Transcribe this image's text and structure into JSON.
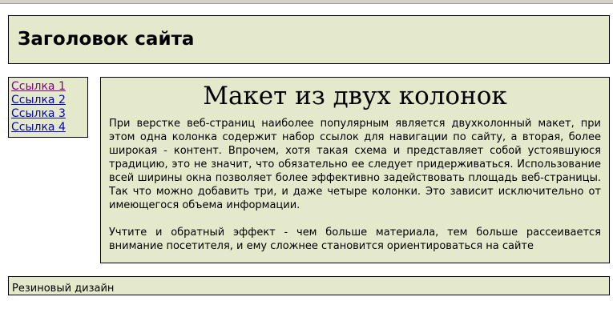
{
  "header": {
    "title": "Заголовок сайта"
  },
  "nav": {
    "links": [
      "Ссылка 1",
      "Ссылка 2",
      "Ссылка 3",
      "Ссылка 4"
    ]
  },
  "content": {
    "heading": "Макет из двух колонок",
    "paragraphs": [
      "При верстке веб-страниц наиболее популярным является двухколонный макет, при этом одна колонка содержит набор ссылок для навигации по сайту, а вторая, более широкая - контент. Впрочем, хотя такая схема и представляет собой устоявшуюся традицию, это не значит, что обязательно ее следует придерживаться. Использование всей ширины окна позволяет более эффективно задействовать площадь веб-страницы. Так что можно добавить три, и даже четыре колонки. Это зависит исключительно от имеющегося объема информации.",
      "Учтите и обратный эффект - чем больше материала, тем больше рассеивается внимание посетителя, и ему сложнее становится ориентироваться на сайте"
    ]
  },
  "footer": {
    "text": "Резиновый дизайн"
  }
}
